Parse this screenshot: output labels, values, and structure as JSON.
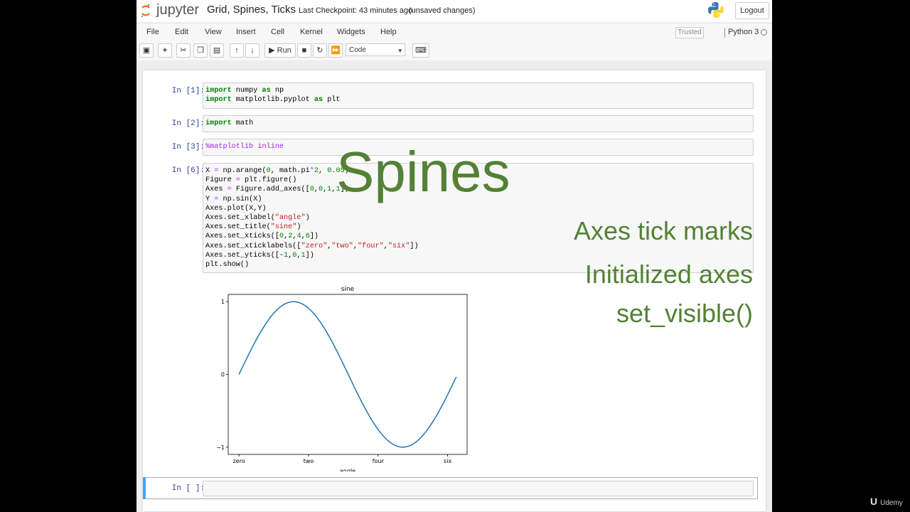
{
  "header": {
    "logo_text": "jupyter",
    "notebook_title": "Grid, Spines, Ticks",
    "checkpoint": "Last Checkpoint: 43 minutes ago",
    "unsaved": "(unsaved changes)",
    "logout_label": "Logout"
  },
  "menubar": {
    "items": [
      "File",
      "Edit",
      "View",
      "Insert",
      "Cell",
      "Kernel",
      "Widgets",
      "Help"
    ],
    "trusted": "Trusted",
    "kernel": "Python 3"
  },
  "toolbar": {
    "run_label": "Run",
    "cell_type": "Code"
  },
  "cells": [
    {
      "prompt": "In [1]:",
      "lines": [
        "import numpy as np",
        "import matplotlib.pyplot as plt"
      ]
    },
    {
      "prompt": "In [2]:",
      "lines": [
        "import math"
      ]
    },
    {
      "prompt": "In [3]:",
      "lines": [
        "%matplotlib inline"
      ]
    },
    {
      "prompt": "In [6]:",
      "lines": [
        "X = np.arange(0, math.pi*2, 0.05)",
        "Figure = plt.figure()",
        "Axes = Figure.add_axes([0,0,1,1])",
        "Y = np.sin(X)",
        "Axes.plot(X,Y)",
        "Axes.set_xlabel(\"angle\")",
        "Axes.set_title(\"sine\")",
        "Axes.set_xticks([0,2,4,6])",
        "Axes.set_xticklabels([\"zero\",\"two\",\"four\",\"six\"])",
        "Axes.set_yticks([-1,0,1])",
        "plt.show()"
      ]
    },
    {
      "prompt": "In [ ]:",
      "lines": []
    }
  ],
  "chart_data": {
    "type": "line",
    "title": "sine",
    "xlabel": "angle",
    "ylabel": "",
    "xticks": [
      0,
      2,
      4,
      6
    ],
    "xticklabels": [
      "zero",
      "two",
      "four",
      "six"
    ],
    "yticks": [
      -1,
      0,
      1
    ],
    "yticklabels": [
      "−1",
      "0",
      "1"
    ],
    "xlim": [
      -0.31,
      6.56
    ],
    "ylim": [
      -1.1,
      1.1
    ],
    "x_start": 0,
    "x_end": 6.25,
    "x_step": 0.05,
    "function": "sin",
    "line_color": "#1f77b4"
  },
  "overlay": {
    "title": "Spines",
    "bullets": [
      "Axes tick marks",
      "Initialized axes",
      "set_visible()"
    ],
    "color": "#538135"
  },
  "watermark": "Udemy"
}
